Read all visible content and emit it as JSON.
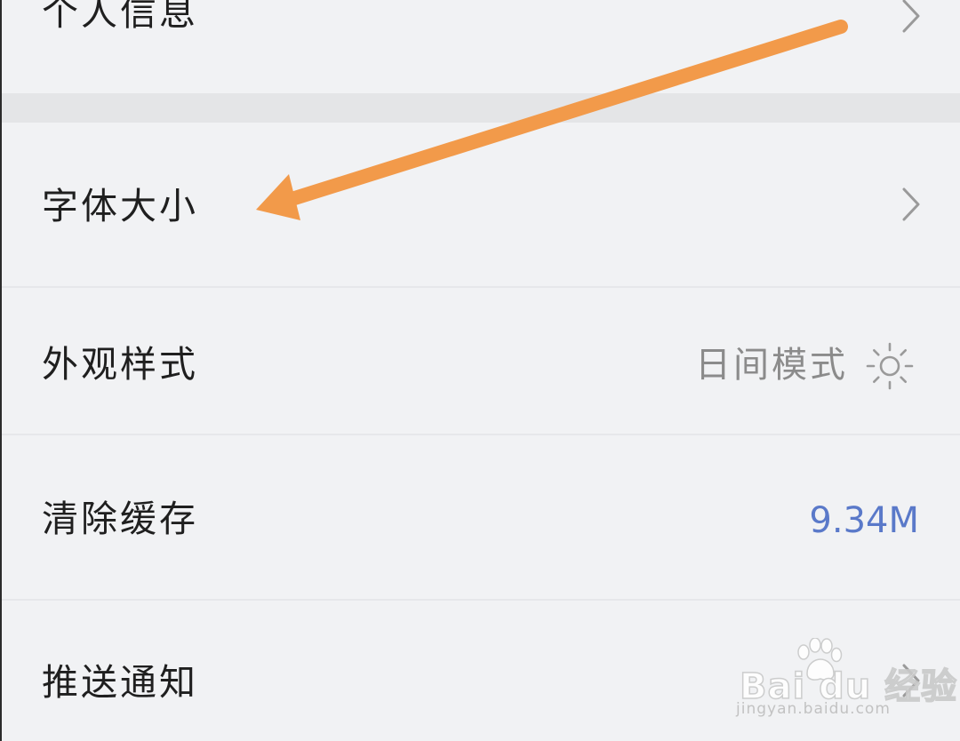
{
  "settings": {
    "rows": [
      {
        "label": "个人信息",
        "has_chevron": true
      },
      {
        "label": "字体大小",
        "has_chevron": true
      },
      {
        "label": "外观样式",
        "value": "日间模式",
        "value_icon": "sun-icon"
      },
      {
        "label": "清除缓存",
        "value": "9.34M"
      },
      {
        "label": "推送通知",
        "has_chevron": true
      }
    ]
  },
  "annotation": {
    "arrow_color": "#f29a4a",
    "points_to": "字体大小"
  },
  "watermark": {
    "brand": "Bai du 经验",
    "url": "jingyan.baidu.com"
  },
  "colors": {
    "background": "#f1f2f4",
    "text": "#1f1f1f",
    "muted_value": "#8b8b8b",
    "accent_value": "#5a79c9",
    "chevron": "#9a9a9a"
  }
}
